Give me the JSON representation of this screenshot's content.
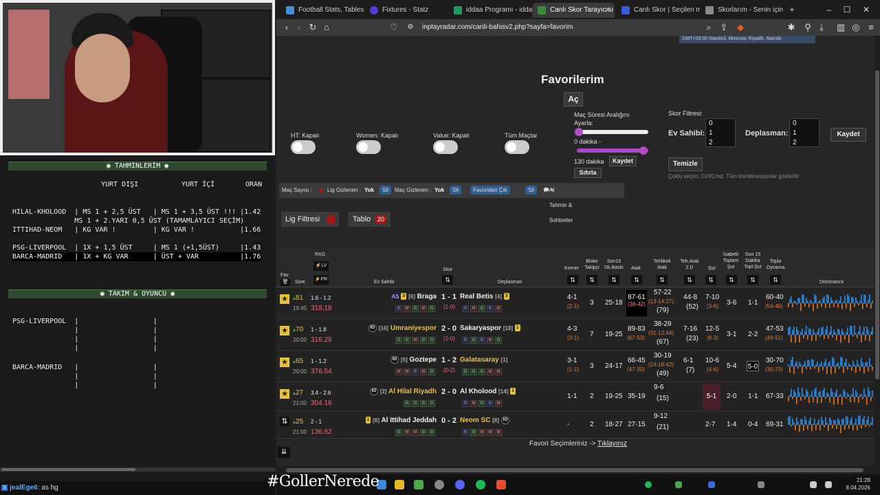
{
  "notes": {
    "tahmin_header": "TAHMİNLERİM",
    "col_yurt_disi": "YURT DIŞI",
    "col_yurt_ici": "YURT İÇİ",
    "col_oran": "ORAN",
    "lines": [
      "HILAL-KHOLOOD  | MS 1 + 2,5 ÜST   | MS 1 + 3,5 ÜST !!! |1.42",
      "               MS 1 + 2.YARI 0,5 ÜST (TAMAMLAYICI SEÇİM)",
      "ITTIHAD-NEOM   | KG VAR !         | KG VAR !           |1.66",
      "",
      "PSG-LIVERPOOL  | 1X + 1,5 ÜST     | MS 1 (+1,5ÜST)     |1.43",
      "BARCA-MADRID   | 1X + KG VAR      | ÜST + VAR          |1.76"
    ],
    "takim_header": "TAKIM & OYUNCU",
    "takim_lines": [
      "PSG-LIVERPOOL  |                  |",
      "               |                  |",
      "               |                  |",
      "               |                  |",
      "",
      "BARCA-MADRID   |                  |",
      "               |                  |",
      "               |                  |"
    ]
  },
  "chat": {
    "user": "jealEge6",
    "message": ": as hg"
  },
  "browser": {
    "tabs": [
      "Football Stats, Tables & D",
      "Fixtures - Statz",
      "iddaa Programı - iddaa B",
      "Canlı Skor Tarayıcısı",
      "Canlı Skor | Seçilen maç",
      "Skorlarım - Senin için Kiş"
    ],
    "url": "inplayradar.com/canli-bahisv2.php?sayfa=favorim",
    "timezone": "GMT+03:00 Istanbul, Moscow, Riyadh, Nairobi"
  },
  "page": {
    "title": "Favorilerim",
    "ac_label": "Aç",
    "toggles": [
      "HT: Kapalı",
      "Women: Kapalı",
      "Value: Kapalı",
      "Tüm Maçlar"
    ],
    "mac_suresi_label": "Maç Süresi Aralığını",
    "ayarla": "Ayarla:",
    "min_dakika": "0 dakika -",
    "max_dakika": "130 dakika",
    "kaydet": "Kaydet",
    "sifirla": "Sıfırla",
    "skor_filtresi": "Skor Filtresi:",
    "ev_sahibi": "Ev Sahibi:",
    "deplasman": "Deplasman:",
    "score_options": [
      "0",
      "1",
      "2"
    ],
    "temizle": "Temizle",
    "coklu_secim": "Çoklu seçim: Ctrl/Cmd. Tüm kombinasyonlar gösterilir.",
    "filterbar": {
      "mac_sayisi": "Maç Sayısı :",
      "lig_gizlenen": "Lig Gizlenen :",
      "yok1": "Yok",
      "sil1": "Sil",
      "mac_gizlenen": "Maç Gizlenen :",
      "yok2": "Yok",
      "sil2": "Sil",
      "favoriden_cik": "Favoriden Çık",
      "sil3": "Sil",
      "ai_tahmin": "AI Tahmin & Sohbetler"
    },
    "lig_filtresi": "Lig Filtresi",
    "tablo": "Tablo",
    "tablo_count": "20",
    "footer": "Favori Seçimleriniz ->",
    "footer_link": "Tıklayınız"
  },
  "table": {
    "headers": {
      "fav": "Fav",
      "sure": "Süre",
      "rxg": "RXG",
      "lv": "LV",
      "pr": "PR",
      "ev_sahibi": "Ev Sahibi",
      "skor": "Skor",
      "deplasman": "Deplasman",
      "korner": "Korner",
      "bloke": "Bloke Takipçi",
      "son15": "Son15 Dk.Baskı",
      "atak": "Atak",
      "tehlikeli": "Tehlikeli Atak",
      "teh_atak": "Teh.Atak 2.D",
      "sut": "Şut",
      "isabetli": "İsabetli Toplam Şut",
      "son15_sut": "Son 15 Dakika Topl.Şut",
      "topla": "Topla Oynama",
      "dominance": "Dominance"
    },
    "rows": [
      {
        "min": "81",
        "time": "19:45",
        "rxg": "1.6 - 1.2",
        "pr": "318.18",
        "home": "Braga",
        "home_rank": "[6]",
        "home_pre": "AS",
        "home_badge": "3",
        "score": "1 - 1",
        "ht": "(1-0)",
        "away": "Real Betis",
        "away_rank": "[4]",
        "away_badge": "3",
        "home_form": [
          "B",
          "M",
          "G",
          "M",
          "G"
        ],
        "away_form": [
          "B",
          "M",
          "G",
          "B",
          "M"
        ],
        "korner": "4-1",
        "korner_ht": "(2-1)",
        "bloke": "3",
        "son15": "25-18",
        "atak": "87-61",
        "atak_sub": "(36-42)",
        "tehlikeli": "57-22",
        "tehlikeli_sub": "(13-14:27)",
        "tehlikeli_sub2": "(79)",
        "teh2": "44-8",
        "teh2_sub": "(52)",
        "sut": "7-10",
        "sut_sub": "(3-6)",
        "isabetli": "3-6",
        "son15sut": "1-1",
        "topla": "60-40",
        "topla_sub": "(54-46)"
      },
      {
        "min": "70",
        "time": "20:00",
        "rxg": "1 - 1.8",
        "pr": "316.26",
        "home": "Umraniyespor",
        "home_rank": "[16]",
        "home_pre": "IO",
        "home_badge": "",
        "score": "2 - 0",
        "ht": "(1-0)",
        "away": "Sakaryaspor",
        "away_rank": "[18]",
        "away_badge": "1",
        "home_form": [
          "G",
          "G",
          "M",
          "G",
          "G"
        ],
        "away_form": [
          "B",
          "G",
          "B",
          "M",
          "G"
        ],
        "korner": "4-3",
        "korner_ht": "(3-1)",
        "bloke": "7",
        "son15": "19-25",
        "atak": "89-83",
        "atak_sub": "(67-53)",
        "tehlikeli": "38-29",
        "tehlikeli_sub": "(31-13:44)",
        "tehlikeli_sub2": "(67)",
        "teh2": "7-16",
        "teh2_sub": "(23)",
        "sut": "12-5",
        "sut_sub": "(8-3)",
        "isabetli": "3-1",
        "son15sut": "2-2",
        "topla": "47-53",
        "topla_sub": "(49-51)"
      },
      {
        "min": "65",
        "time": "20:00",
        "rxg": "1 - 1.2",
        "pr": "376.54",
        "home": "Goztepe",
        "home_rank": "[5]",
        "home_pre": "IO",
        "home_badge": "",
        "score": "1 - 2",
        "ht": "(0-2)",
        "away": "Galatasaray",
        "away_rank": "[1]",
        "away_badge": "",
        "home_form": [
          "M",
          "M",
          "B",
          "M",
          "G"
        ],
        "away_form": [
          "G",
          "G",
          "G",
          "M",
          "M"
        ],
        "korner": "3-1",
        "korner_ht": "(1-1)",
        "bloke": "3",
        "son15": "24-17",
        "atak": "66-45",
        "atak_sub": "(47-30)",
        "tehlikeli": "30-19",
        "tehlikeli_sub": "(24-18:42)",
        "tehlikeli_sub2": "(49)",
        "teh2": "6-1",
        "teh2_sub": "(7)",
        "sut": "10-6",
        "sut_sub": "(4-6)",
        "isabetli": "5-4",
        "son15sut": "5-0",
        "topla": "30-70",
        "topla_sub": "(30-70)"
      },
      {
        "min": "27",
        "time": "21:00",
        "rxg": "3.4 - 2.6",
        "pr": "304.16",
        "home": "Al Hilal Riyadh",
        "home_rank": "[2]",
        "home_pre": "IO",
        "home_badge": "",
        "score": "2 - 0",
        "ht": "",
        "away": "Al Kholood",
        "away_rank": "[14]",
        "away_badge": "1",
        "home_form": [
          "G",
          "G",
          "G",
          "G"
        ],
        "away_form": [
          "B",
          "M",
          "G",
          "B",
          "M"
        ],
        "korner": "1-1",
        "korner_ht": "",
        "bloke": "2",
        "son15": "19-25",
        "atak": "35-19",
        "atak_sub": "",
        "tehlikeli": "9-6",
        "tehlikeli_sub": "",
        "tehlikeli_sub2": "(15)",
        "teh2": "",
        "teh2_sub": "",
        "sut": "5-1",
        "sut_sub": "",
        "isabetli": "2-0",
        "son15sut": "1-1",
        "topla": "67-33",
        "topla_sub": ""
      },
      {
        "min": "25",
        "time": "21:00",
        "rxg": "2 - 1",
        "pr": "136.82",
        "home": "Al Ittihad Jeddah",
        "home_rank": "[6]",
        "home_pre": "",
        "home_badge": "1",
        "score": "0 - 2",
        "ht": "",
        "away": "Neom SC",
        "away_rank": "[8]",
        "away_badge": "IO",
        "home_form": [
          "G",
          "M",
          "M",
          "G",
          "G"
        ],
        "away_form": [
          "B",
          "G",
          "M",
          "M",
          "M"
        ],
        "korner": "-",
        "korner_ht": "",
        "bloke": "2",
        "son15": "18-27",
        "atak": "27-15",
        "atak_sub": "",
        "tehlikeli": "9-12",
        "tehlikeli_sub": "",
        "tehlikeli_sub2": "(21)",
        "teh2": "",
        "teh2_sub": "",
        "sut": "2-7",
        "sut_sub": "",
        "isabetli": "1-4",
        "son15sut": "0-4",
        "topla": "69-31",
        "topla_sub": ""
      }
    ]
  },
  "taskbar": {
    "hashtag": "#GollerNerede",
    "time": "21:28",
    "date": "8.04.2026"
  }
}
